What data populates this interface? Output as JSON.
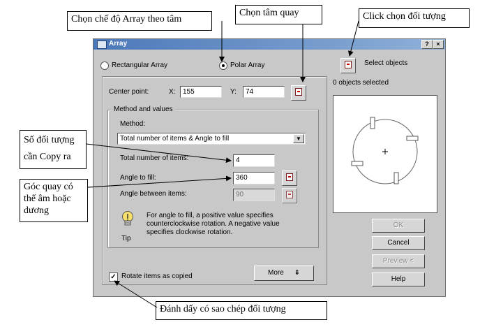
{
  "dialog": {
    "title": "Array",
    "help_btn": "?",
    "close_btn": "×",
    "rectangular_label": "Rectangular Array",
    "polar_label": "Polar Array",
    "selected_mode": "polar",
    "select_objects_label": "Select objects",
    "objects_selected": "0 objects selected",
    "center_point_label": "Center point:",
    "x_label": "X:",
    "x_value": "155",
    "y_label": "Y:",
    "y_value": "74",
    "method_group_title": "Method and values",
    "method_label": "Method:",
    "method_value": "Total number of items & Angle to fill",
    "total_items_label": "Total number of items:",
    "total_items_value": "4",
    "angle_fill_label": "Angle to fill:",
    "angle_fill_value": "360",
    "angle_between_label": "Angle between items:",
    "angle_between_value": "90",
    "tip_text": "For angle to fill, a positive value specifies counterclockwise rotation.  A negative value specifies clockwise rotation.",
    "tip_label": "Tip",
    "rotate_label": "Rotate items as copied",
    "rotate_checked": true,
    "more_button": "More",
    "ok_button": "OK",
    "cancel_button": "Cancel",
    "preview_button": "Preview <",
    "help_button": "Help"
  },
  "annotations": {
    "polar_mode": "Chọn chế độ Array theo tâm",
    "center_pick": "Chọn tâm quay",
    "select_obj": "Click chọn đối tượng",
    "copy_count": "Số đối tượng cần Copy ra",
    "angle": "Góc quay có thể âm hoặc dương",
    "rotate": "Đánh dấy có sao chép đối tượng"
  }
}
